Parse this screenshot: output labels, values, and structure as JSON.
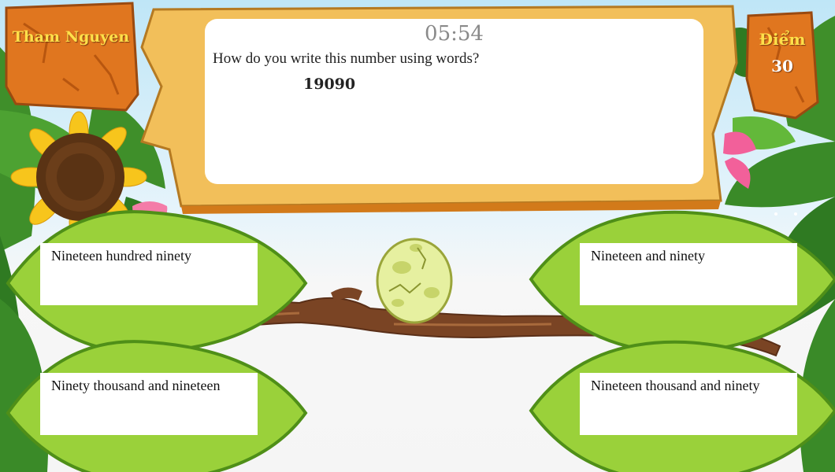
{
  "player": {
    "name": "Tham Nguyen"
  },
  "score": {
    "label": "Điểm",
    "value": "30"
  },
  "question": {
    "timer": "05:54",
    "prompt": "How do you write this number using words?",
    "number": "19090"
  },
  "answers": [
    {
      "label": "Nineteen hundred ninety"
    },
    {
      "label": "Nineteen and ninety"
    },
    {
      "label": "Ninety thousand and nineteen"
    },
    {
      "label": "Nineteen thousand and ninety"
    }
  ],
  "colors": {
    "wood": "#e0761f",
    "banner": "#f2bf5a",
    "leaf": "#9ad13a",
    "leaf_edge": "#4f8f18",
    "branch": "#7a4424",
    "egg": "#e6f0a0",
    "name_text": "#ffe04a"
  }
}
